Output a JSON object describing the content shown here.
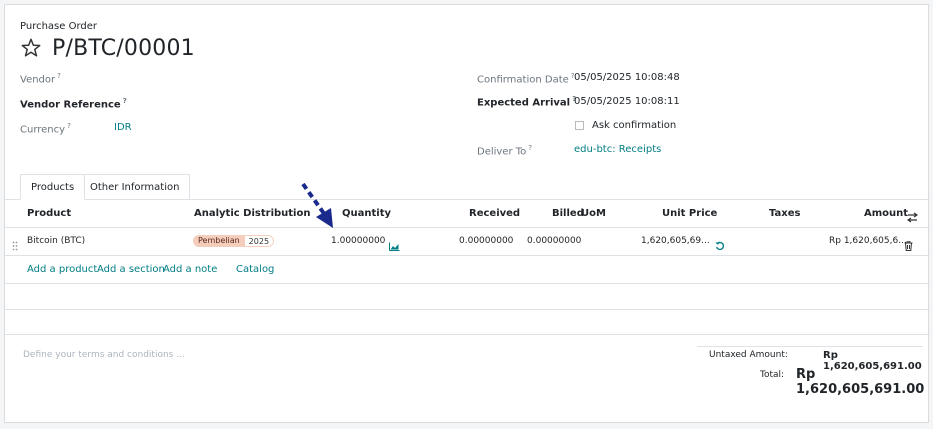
{
  "header": {
    "breadcrumb": "Purchase Order",
    "title": "P/BTC/00001"
  },
  "fields": {
    "vendor_label": "Vendor",
    "vendor_reference_label": "Vendor Reference",
    "currency_label": "Currency",
    "currency_value": "IDR",
    "confirmation_date_label": "Confirmation Date",
    "confirmation_date_value": "05/05/2025 10:08:48",
    "expected_arrival_label": "Expected Arrival",
    "expected_arrival_value": "05/05/2025 10:08:11",
    "ask_confirmation_label": "Ask confirmation",
    "deliver_to_label": "Deliver To",
    "deliver_to_value": "edu-btc: Receipts",
    "help_mark": "?"
  },
  "tabs": [
    {
      "label": "Products",
      "active": true
    },
    {
      "label": "Other Information",
      "active": false
    }
  ],
  "table": {
    "headers": {
      "product": "Product",
      "analytic": "Analytic Distribution",
      "quantity": "Quantity",
      "received": "Received",
      "billed": "Billed",
      "uom": "UoM",
      "unit_price": "Unit Price",
      "taxes": "Taxes",
      "amount": "Amount"
    },
    "rows": [
      {
        "product": "Bitcoin (BTC)",
        "analytic_tag": "Pembelian",
        "analytic_tag_year": "2025",
        "quantity": "1.00000000",
        "received": "0.00000000",
        "billed": "0.00000000",
        "uom": "",
        "unit_price": "1,620,605,69...",
        "taxes": "",
        "amount": "Rp 1,620,605,6..."
      }
    ],
    "actions": {
      "add_product": "Add a product",
      "add_section": "Add a section",
      "add_note": "Add a note",
      "catalog": "Catalog"
    }
  },
  "footer": {
    "terms_placeholder": "Define your terms and conditions ...",
    "untaxed_label": "Untaxed Amount:",
    "untaxed_value": "Rp 1,620,605,691.00",
    "total_label": "Total:",
    "total_value": "Rp 1,620,605,691.00"
  },
  "colors": {
    "link": "#017e84",
    "arrow": "#1a2a8c",
    "tag_bg": "#f5cdbd"
  },
  "icons": [
    "star-icon",
    "forecast-chart-icon",
    "reset-price-icon",
    "delete-icon",
    "column-settings-icon",
    "drag-handle-icon",
    "annotation-arrow-icon"
  ]
}
